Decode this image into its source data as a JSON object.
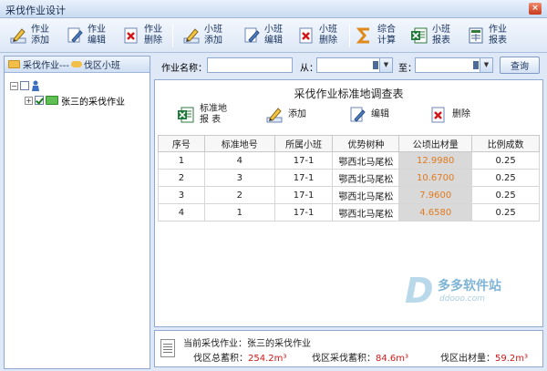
{
  "window": {
    "title": "采伐作业设计",
    "close_label": "×"
  },
  "toolbar": {
    "buttons": [
      {
        "label1": "作业",
        "label2": "添加",
        "icon": "add-pencil-icon"
      },
      {
        "label1": "作业",
        "label2": "编辑",
        "icon": "edit-icon"
      },
      {
        "label1": "作业",
        "label2": "删除",
        "icon": "delete-icon"
      },
      {
        "label1": "小班",
        "label2": "添加",
        "icon": "add-pencil-icon"
      },
      {
        "label1": "小班",
        "label2": "编辑",
        "icon": "edit-icon"
      },
      {
        "label1": "小班",
        "label2": "删除",
        "icon": "delete-icon"
      },
      {
        "label1": "综合",
        "label2": "计算",
        "icon": "sigma-icon"
      },
      {
        "label1": "小班",
        "label2": "报表",
        "icon": "excel-icon"
      },
      {
        "label1": "作业",
        "label2": "报表",
        "icon": "excel-report-icon"
      }
    ]
  },
  "left_panel": {
    "tab_label1": "采伐作业---",
    "tab_label2": "伐区小班",
    "tree_item": "张三的采伐作业"
  },
  "search": {
    "name_label": "作业名称：",
    "name_value": "",
    "from_label": "从：",
    "from_value": "",
    "to_label": "至：",
    "to_value": "",
    "query_label": "查询"
  },
  "main": {
    "title": "采伐作业标准地调查表",
    "actions": {
      "report_label1": "标准地",
      "report_label2": "报  表",
      "add_label": "添加",
      "edit_label": "编辑",
      "delete_label": "删除"
    },
    "table": {
      "headers": [
        "序号",
        "标准地号",
        "所属小班",
        "优势树种",
        "公顷出材量",
        "比例成数"
      ],
      "rows": [
        [
          "1",
          "4",
          "17-1",
          "鄂西北马尾松",
          "12.9980",
          "0.25"
        ],
        [
          "2",
          "3",
          "17-1",
          "鄂西北马尾松",
          "10.6700",
          "0.25"
        ],
        [
          "3",
          "2",
          "17-1",
          "鄂西北马尾松",
          "7.9600",
          "0.25"
        ],
        [
          "4",
          "1",
          "17-1",
          "鄂西北马尾松",
          "4.6580",
          "0.25"
        ]
      ]
    },
    "watermark": {
      "brand": "多多软件站",
      "url": "ddooo.com",
      "letter": "D"
    }
  },
  "status": {
    "current_label": "当前采伐作业：张三的采伐作业",
    "total_stock_label": "伐区总蓄积：",
    "total_stock_value": "254.2m³",
    "cut_stock_label": "伐区采伐蓄积：",
    "cut_stock_value": "84.6m³",
    "timber_label": "伐区出材量：",
    "timber_value": "59.2m³"
  },
  "colors": {
    "accent": "#1b4f8f",
    "area_highlight": "#e07a20",
    "status_value": "#d0181a"
  }
}
